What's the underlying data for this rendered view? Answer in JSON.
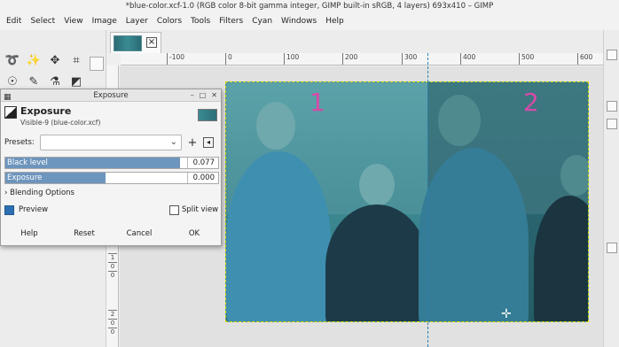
{
  "window": {
    "title": "*blue-color.xcf-1.0 (RGB color 8-bit gamma integer, GIMP built-in sRGB, 4 layers) 693x410 – GIMP"
  },
  "menu": [
    "Edit",
    "Select",
    "View",
    "Image",
    "Layer",
    "Colors",
    "Tools",
    "Filters",
    "Cyan",
    "Windows",
    "Help"
  ],
  "ruler_top": [
    "-100",
    "0",
    "100",
    "200",
    "300",
    "400",
    "500",
    "600"
  ],
  "ruler_left": [
    "1",
    "0",
    "0",
    "2",
    "0",
    "0",
    "3",
    "0"
  ],
  "image": {
    "label_left": "1",
    "label_right": "2"
  },
  "dialog": {
    "window_title": "Exposure",
    "heading": "Exposure",
    "subheading": "Visible-9 (blue-color.xcf)",
    "presets_label": "Presets:",
    "presets_value": "",
    "black_level": {
      "label": "Black level",
      "value": "0.077",
      "fill_fraction": 0.82
    },
    "exposure": {
      "label": "Exposure",
      "value": "0.000",
      "fill_fraction": 0.47
    },
    "blending_options": "Blending Options",
    "preview_label": "Preview",
    "preview_checked": true,
    "split_view_label": "Split view",
    "split_view_checked": false,
    "buttons": {
      "help": "Help",
      "reset": "Reset",
      "cancel": "Cancel",
      "ok": "OK"
    }
  },
  "colors": {
    "accent": "#6d95bd",
    "number_label": "#d64aa8",
    "guide": "#2b7fb5"
  }
}
